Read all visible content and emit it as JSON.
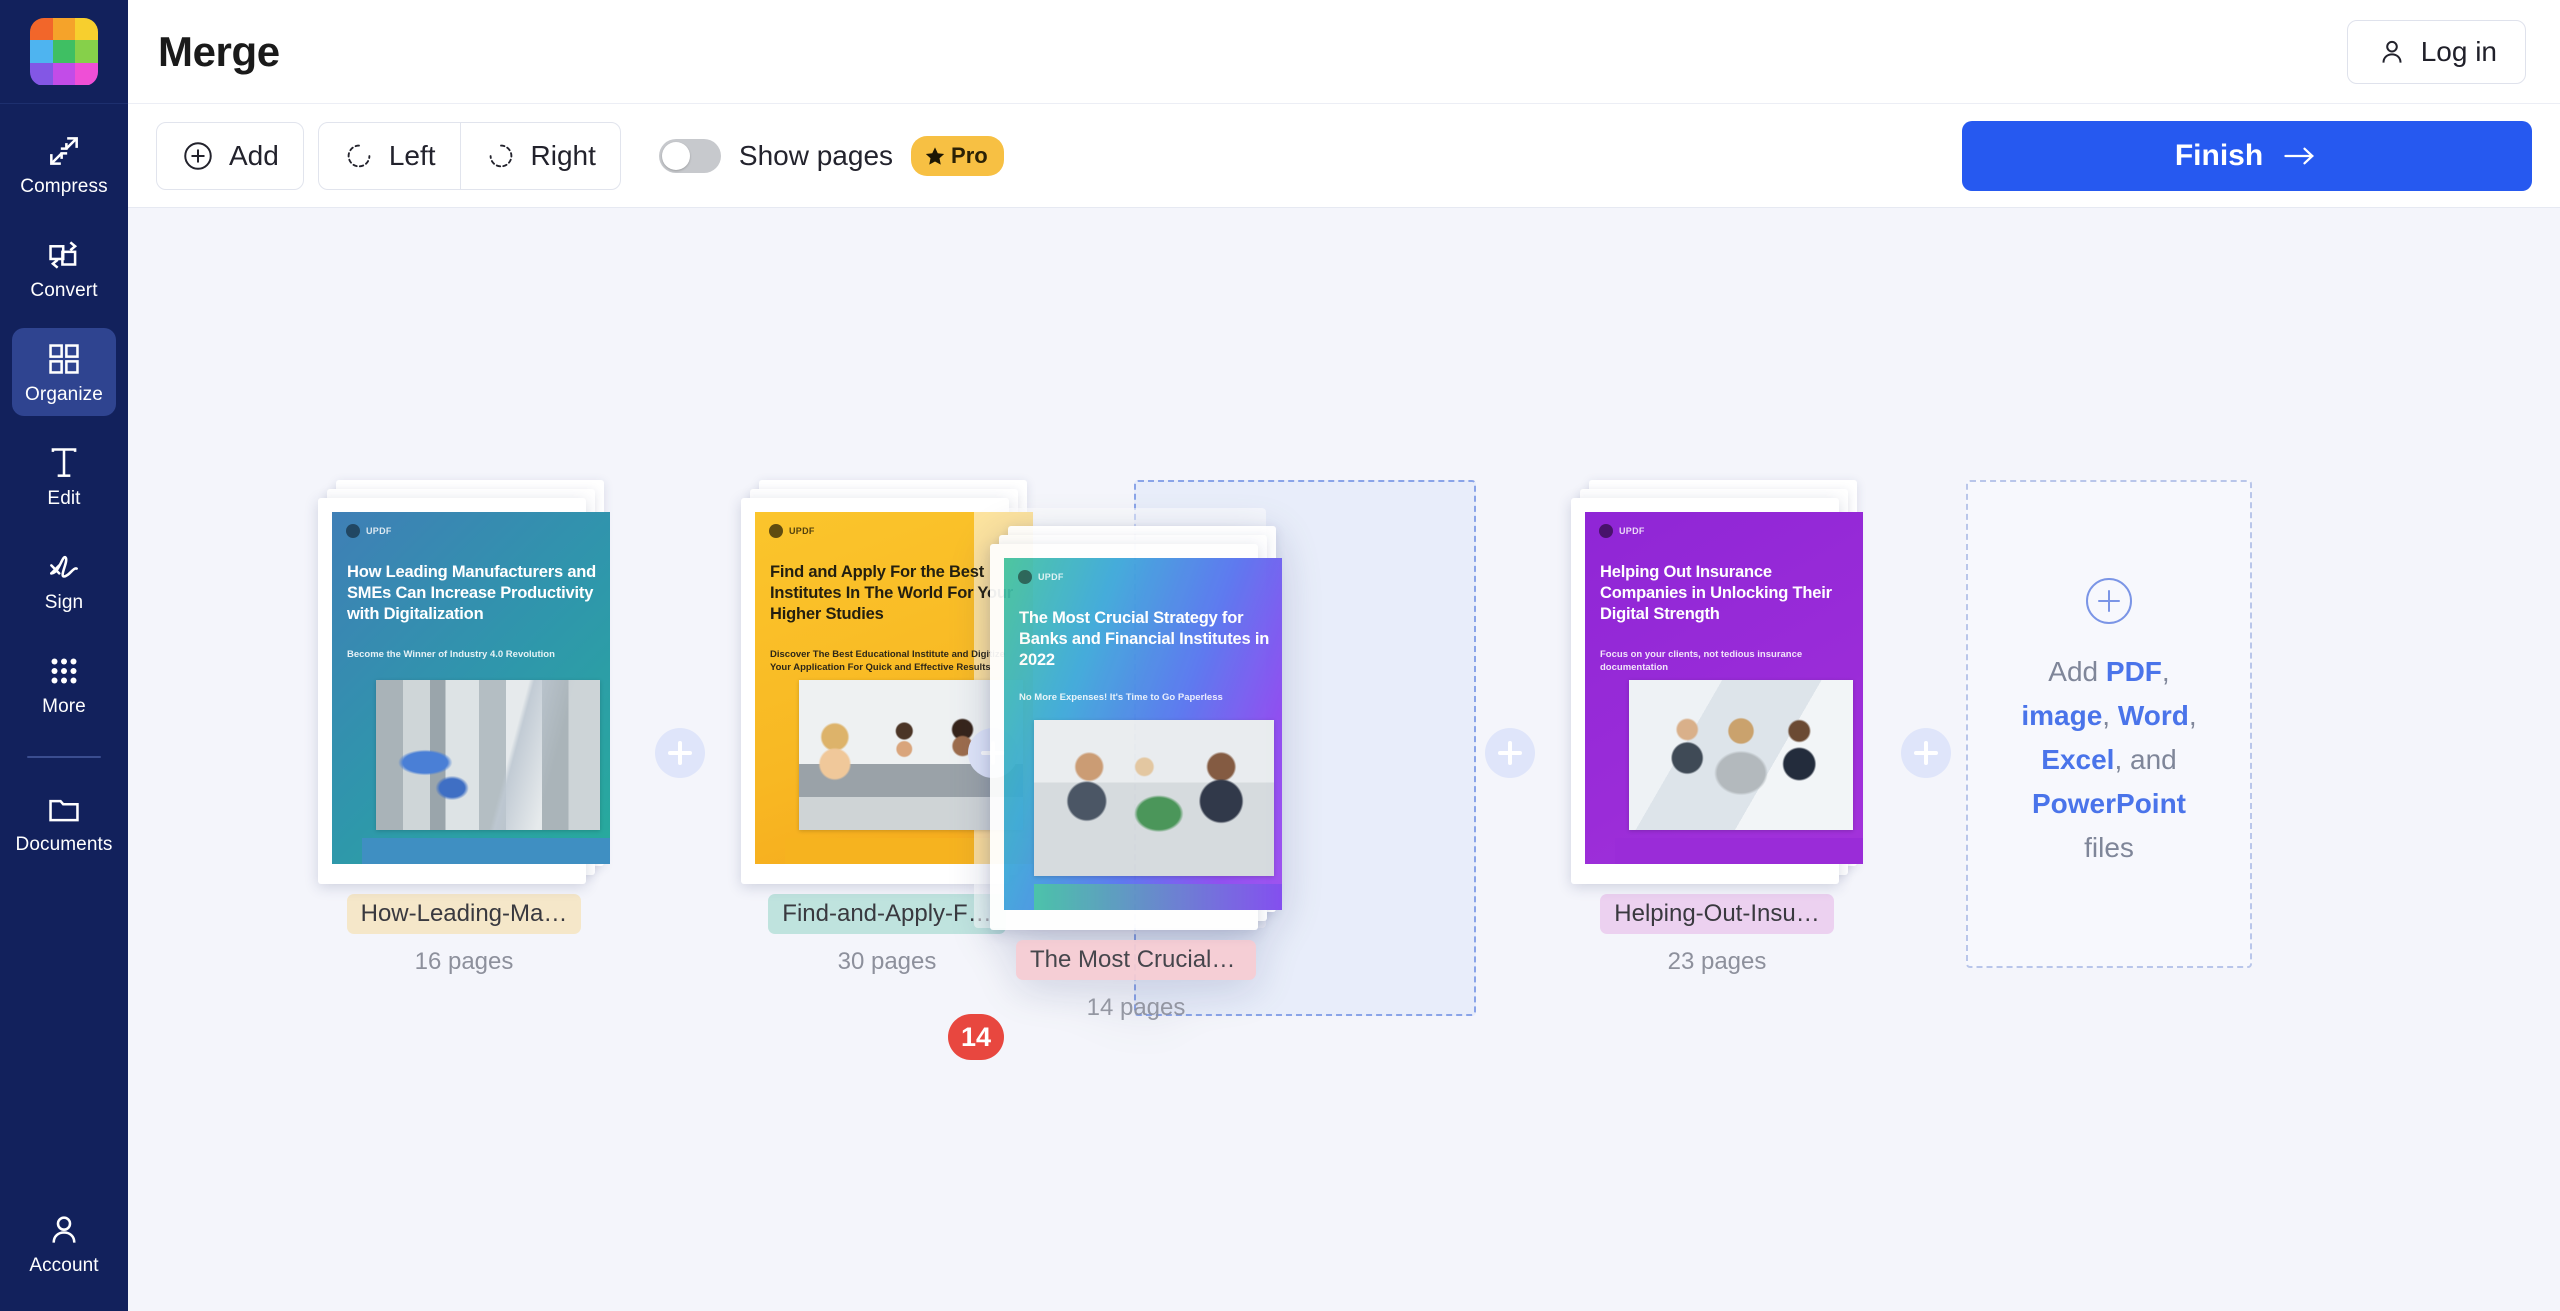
{
  "sidebar": {
    "logo_colors": [
      "#f2662a",
      "#f5a32a",
      "#f7cf2e",
      "#4eb4f0",
      "#3fbf63",
      "#86d04a",
      "#8357e5",
      "#c24ce8",
      "#ef4fd6"
    ],
    "items": [
      {
        "label": "Compress",
        "icon": "compress-icon",
        "active": false
      },
      {
        "label": "Convert",
        "icon": "convert-icon",
        "active": false
      },
      {
        "label": "Organize",
        "icon": "organize-icon",
        "active": true
      },
      {
        "label": "Edit",
        "icon": "edit-icon",
        "active": false
      },
      {
        "label": "Sign",
        "icon": "sign-icon",
        "active": false
      },
      {
        "label": "More",
        "icon": "more-icon",
        "active": false
      },
      {
        "label": "Documents",
        "icon": "folder-icon",
        "active": false
      }
    ],
    "account": {
      "label": "Account",
      "icon": "user-icon"
    }
  },
  "header": {
    "title": "Merge",
    "login_label": "Log in",
    "login_icon": "user-icon"
  },
  "toolbar": {
    "add_label": "Add",
    "add_icon": "plus-circle-icon",
    "rotate_left_label": "Left",
    "rotate_left_icon": "rotate-left-icon",
    "rotate_right_label": "Right",
    "rotate_right_icon": "rotate-right-icon",
    "show_pages_label": "Show pages",
    "show_pages_on": false,
    "pro_badge": "Pro",
    "pro_badge_icon": "star-icon",
    "pro_badge_color": "#f7c043",
    "finish_label": "Finish",
    "finish_icon": "arrow-right-icon",
    "finish_color": "#2659f0"
  },
  "documents": [
    {
      "name": "How-Leading-Ma…",
      "pages": "16 pages",
      "chip_color": "#f5e7c9",
      "cover": {
        "title": "How Leading Manufacturers and SMEs Can Increase Productivity with Digitalization",
        "subtitle": "Become the Winner of Industry 4.0 Revolution",
        "brand": "UPDF",
        "gradient_from": "#3f7fb6",
        "gradient_to": "#2aa79b",
        "title_dark": false
      }
    },
    {
      "name": "Find-and-Apply-F…",
      "pages": "30 pages",
      "chip_color": "#bfe3de",
      "cover": {
        "title": "Find and Apply For the Best Institutes In The World For Your Higher Studies",
        "subtitle": "Discover The Best Educational Institute and Digitize Your Application For Quick and Effective Results",
        "brand": "UPDF",
        "gradient_from": "#fbc02a",
        "gradient_to": "#f6a91f",
        "title_dark": true
      }
    },
    {
      "name": "Helping-Out-Insu…",
      "pages": "23 pages",
      "chip_color": "#ecd1f0",
      "cover": {
        "title": "Helping Out Insurance Companies in Unlocking Their Digital Strength",
        "subtitle": "Focus on your clients, not tedious insurance documentation",
        "brand": "UPDF",
        "gradient_from": "#8d26d4",
        "gradient_to": "#9f2fd9",
        "title_dark": false
      }
    }
  ],
  "dragging_document": {
    "name": "The Most Crucial …",
    "pages": "14 pages",
    "chip_color": "#f6ccd3",
    "badge_count": "14",
    "badge_color": "#e8473f",
    "cover": {
      "title": "The Most Crucial Strategy for Banks and Financial Institutes in 2022",
      "subtitle": "No More Expenses! It's Time to Go Paperless",
      "brand": "UPDF",
      "gradient_from": "#3fc0a0",
      "gradient_to": "#7c46f0",
      "title_dark": false
    }
  },
  "add_zone": {
    "icon": "plus-circle-icon",
    "prefix": "Add ",
    "types": [
      "PDF",
      "image",
      "Word",
      "Excel",
      "PowerPoint"
    ],
    "sep1": ", ",
    "sep2": ", and ",
    "suffix": " files",
    "accent_color": "#4a74ea"
  }
}
